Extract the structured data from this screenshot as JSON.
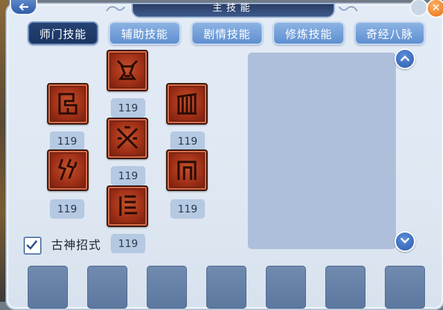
{
  "window": {
    "title": "主技能"
  },
  "tabs": [
    {
      "label": "师门技能",
      "active": true
    },
    {
      "label": "辅助技能",
      "active": false
    },
    {
      "label": "剧情技能",
      "active": false
    },
    {
      "label": "修炼技能",
      "active": false
    },
    {
      "label": "奇经八脉",
      "active": false
    }
  ],
  "skills": [
    {
      "name": "skill-top",
      "level": "119"
    },
    {
      "name": "skill-left-upper",
      "level": "119"
    },
    {
      "name": "skill-right-upper",
      "level": "119"
    },
    {
      "name": "skill-center",
      "level": "119"
    },
    {
      "name": "skill-left-lower",
      "level": "119"
    },
    {
      "name": "skill-right-lower",
      "level": "119"
    },
    {
      "name": "skill-bottom",
      "level": "119"
    }
  ],
  "option": {
    "label": "古神招式",
    "checked": true
  },
  "colors": {
    "active_tab": "#1f3a68",
    "tab": "#6c9ad6",
    "icon_red": "#a8341a",
    "close": "#f07a1a"
  },
  "icons": {
    "back": "back-arrow-icon",
    "help": "help-icon",
    "close": "close-icon",
    "scroll_up": "chevron-up-icon",
    "scroll_down": "chevron-down-icon",
    "check": "checkmark-icon"
  }
}
